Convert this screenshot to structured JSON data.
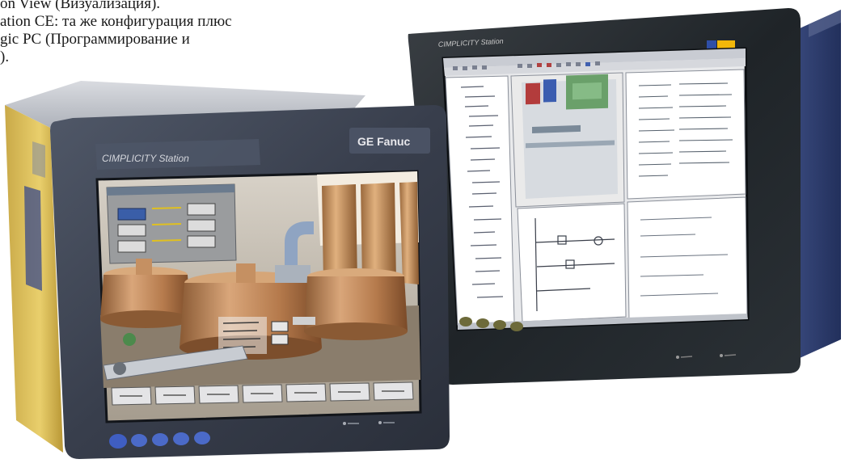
{
  "caption": {
    "line1": "on View (Визуализация).",
    "line2": "ation CE: та же конфигурация плюс",
    "line3": "gic PC (Программирование и",
    "line4": ")."
  },
  "front_panel": {
    "brand": "CIMPLICITY Station",
    "vendor": "GE Fanuc",
    "soft_keys": [
      "",
      "",
      "",
      "",
      "",
      "",
      ""
    ],
    "led_labels": [
      "",
      ""
    ],
    "colors": {
      "bezel": "#3b4150",
      "copper": "#b9825a",
      "screen_bg": "#cfc6b6"
    }
  },
  "rear_panel": {
    "brand": "CIMPLICITY Station",
    "colors": {
      "bezel": "#252a2e",
      "badge_blue": "#2f4fa8",
      "badge_yellow": "#f2b70a",
      "screen_bg": "#e9eaec"
    }
  }
}
